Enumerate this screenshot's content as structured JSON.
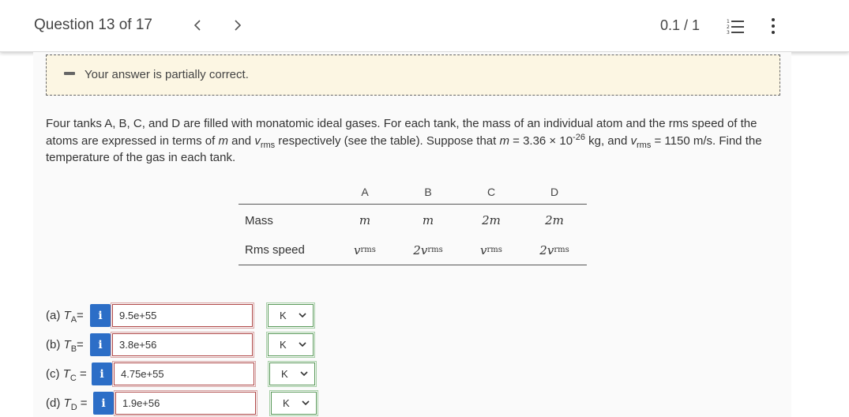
{
  "header": {
    "question_label": "Question 13 of 17",
    "score": "0.1 / 1"
  },
  "feedback": {
    "message": "Your answer is partially correct."
  },
  "problem": {
    "text_1": "Four tanks A, B, C, and D are filled with monatomic ideal gases. For each tank, the mass of an individual atom and the rms speed of the atoms are expressed in terms of ",
    "m_symbol": "m",
    "text_2": " and ",
    "v_symbol": "v",
    "rms_sub": "rms",
    "text_3": " respectively (see the table). Suppose that ",
    "text_4": " = 3.36 × 10",
    "exponent": "-26",
    "text_5": " kg, and ",
    "text_6": " = 1150 m/s. Find the temperature of the gas in each tank."
  },
  "table": {
    "headers": [
      "A",
      "B",
      "C",
      "D"
    ],
    "rows": [
      {
        "label": "Mass",
        "cells": [
          {
            "coef": "",
            "sym": "m",
            "sub": ""
          },
          {
            "coef": "",
            "sym": "m",
            "sub": ""
          },
          {
            "coef": "2",
            "sym": "m",
            "sub": ""
          },
          {
            "coef": "2",
            "sym": "m",
            "sub": ""
          }
        ]
      },
      {
        "label": "Rms speed",
        "cells": [
          {
            "coef": "",
            "sym": "v",
            "sub": "rms"
          },
          {
            "coef": "2",
            "sym": "v",
            "sub": "rms"
          },
          {
            "coef": "",
            "sym": "v",
            "sub": "rms"
          },
          {
            "coef": "2",
            "sym": "v",
            "sub": "rms"
          }
        ]
      }
    ]
  },
  "answers": [
    {
      "part": "(a)",
      "var": "T",
      "sub": "A",
      "eq": "=",
      "value": "9.5e+55",
      "unit": "K"
    },
    {
      "part": "(b)",
      "var": "T",
      "sub": "B",
      "eq": "=",
      "value": "3.8e+56",
      "unit": "K"
    },
    {
      "part": "(c)",
      "var": "T",
      "sub": "C",
      "eq": " =",
      "value": "4.75e+55",
      "unit": "K"
    },
    {
      "part": "(d)",
      "var": "T",
      "sub": "D",
      "eq": " =",
      "value": "1.9e+56",
      "unit": "K"
    }
  ],
  "info_glyph": "i",
  "icons": {
    "prev": "chevron-left-icon",
    "next": "chevron-right-icon",
    "list": "numbered-list-icon",
    "more": "vertical-ellipsis-icon",
    "dropdown": "chevron-down-icon"
  },
  "colors": {
    "info_button": "#2c6ec7",
    "incorrect_border": "#b04848",
    "correct_border": "#5a9a5a",
    "feedback_bg": "#fcf6e3"
  }
}
